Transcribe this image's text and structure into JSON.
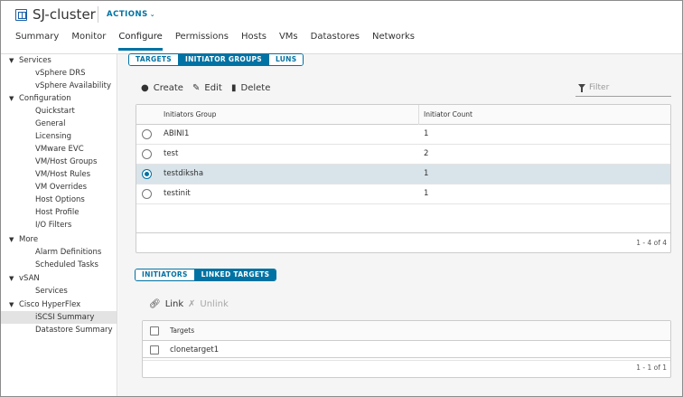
{
  "header": {
    "title": "SJ-cluster",
    "actions_label": "ACTIONS",
    "tabs": [
      {
        "label": "Summary"
      },
      {
        "label": "Monitor"
      },
      {
        "label": "Configure"
      },
      {
        "label": "Permissions"
      },
      {
        "label": "Hosts"
      },
      {
        "label": "VMs"
      },
      {
        "label": "Datastores"
      },
      {
        "label": "Networks"
      }
    ],
    "active_tab": "Configure"
  },
  "sidebar": {
    "groups": [
      {
        "label": "Services",
        "items": [
          "vSphere DRS",
          "vSphere Availability"
        ]
      },
      {
        "label": "Configuration",
        "items": [
          "Quickstart",
          "General",
          "Licensing",
          "VMware EVC",
          "VM/Host Groups",
          "VM/Host Rules",
          "VM Overrides",
          "Host Options",
          "Host Profile",
          "I/O Filters"
        ]
      },
      {
        "label": "More",
        "items": [
          "Alarm Definitions",
          "Scheduled Tasks"
        ]
      },
      {
        "label": "vSAN",
        "items": [
          "Services"
        ]
      },
      {
        "label": "Cisco HyperFlex",
        "items": [
          "iSCSI Summary",
          "Datastore Summary"
        ]
      }
    ],
    "selected_item": "iSCSI Summary"
  },
  "top_segment": {
    "buttons": [
      "TARGETS",
      "INITIATOR GROUPS",
      "LUNS"
    ],
    "active": "INITIATOR GROUPS"
  },
  "toolbar": {
    "create_label": "Create",
    "edit_label": "Edit",
    "delete_label": "Delete",
    "filter_placeholder": "Filter"
  },
  "initiator_grid": {
    "columns": [
      "Initiators Group",
      "Initiator Count"
    ],
    "rows": [
      {
        "name": "ABINI1",
        "count": "1",
        "selected": false
      },
      {
        "name": "test",
        "count": "2",
        "selected": false
      },
      {
        "name": "testdiksha",
        "count": "1",
        "selected": true
      },
      {
        "name": "testinit",
        "count": "1",
        "selected": false
      }
    ],
    "footer": "1 - 4 of 4"
  },
  "bottom_segment": {
    "buttons": [
      "INITIATORS",
      "LINKED TARGETS"
    ],
    "active": "LINKED TARGETS"
  },
  "link_toolbar": {
    "link_label": "Link",
    "unlink_label": "Unlink"
  },
  "targets_grid": {
    "column": "Targets",
    "rows": [
      {
        "name": "clonetarget1"
      }
    ],
    "footer": "1 - 1 of 1"
  },
  "colors": {
    "accent": "#0072a3",
    "selected_row": "#d9e4ea",
    "sidebar_selected": "#e3e3e3"
  }
}
